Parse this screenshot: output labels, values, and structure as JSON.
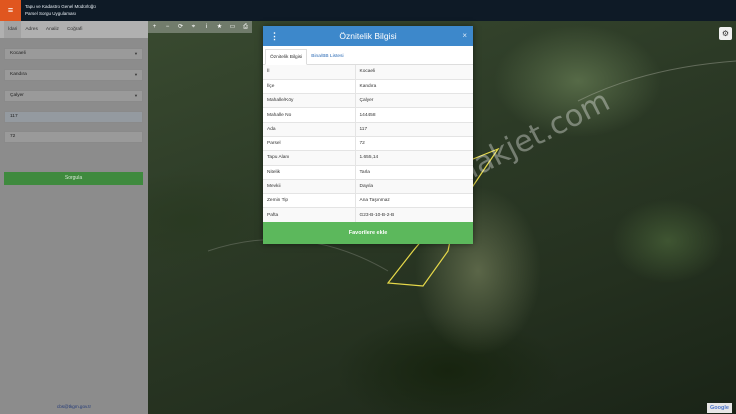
{
  "header": {
    "menu_icon": "hamburger-icon",
    "brand_line1": "Tapu ve Kadastro Genel Müdürlüğü",
    "brand_line2": "Parsel Sorgu Uygulaması"
  },
  "sidebar": {
    "tabs": [
      {
        "label": "İdari"
      },
      {
        "label": "Adres"
      },
      {
        "label": "Analiz"
      },
      {
        "label": "Coğrafi"
      }
    ],
    "province": "Kocaeli",
    "district": "Kandıra",
    "neighborhood": "Çalyer",
    "block": "117",
    "parcel": "72",
    "query_button": "Sorgula",
    "footer_link": "cbs@tkgm.gov.tr"
  },
  "map": {
    "tool_icons": [
      "plus-icon",
      "minus-icon",
      "refresh-icon",
      "crosshair-icon",
      "info-icon",
      "star-icon",
      "ruler-icon",
      "print-icon"
    ],
    "tool_glyphs": [
      "+",
      "−",
      "⟳",
      "⌖",
      "i",
      "★",
      "▭",
      "⎙"
    ],
    "settings_icon": "gear-icon",
    "watermark": "emlakjet.com",
    "google_logo": "Google",
    "parcel_color": "#e6d94a"
  },
  "popup": {
    "title": "Öznitelik Bilgisi",
    "close": "×",
    "tabs": [
      {
        "label": "Öznitelik Bilgisi"
      },
      {
        "label": "Bina/BB Listesi"
      }
    ],
    "rows": [
      {
        "key": "İl",
        "value": "Kocaeli"
      },
      {
        "key": "İlçe",
        "value": "Kandıra"
      },
      {
        "key": "Mahalle/Köy",
        "value": "Çalyer"
      },
      {
        "key": "Mahalle No",
        "value": "144458"
      },
      {
        "key": "Ada",
        "value": "117"
      },
      {
        "key": "Parsel",
        "value": "72"
      },
      {
        "key": "Tapu Alanı",
        "value": "1.655,14"
      },
      {
        "key": "Nitelik",
        "value": "Tarla"
      },
      {
        "key": "Mevkii",
        "value": "Dayıla"
      },
      {
        "key": "Zemin Tip",
        "value": "Ana Taşınmaz"
      },
      {
        "key": "Pafta",
        "value": "G23-B-10-B-2-B"
      }
    ],
    "favorite_button": "Favorilere ekle"
  }
}
